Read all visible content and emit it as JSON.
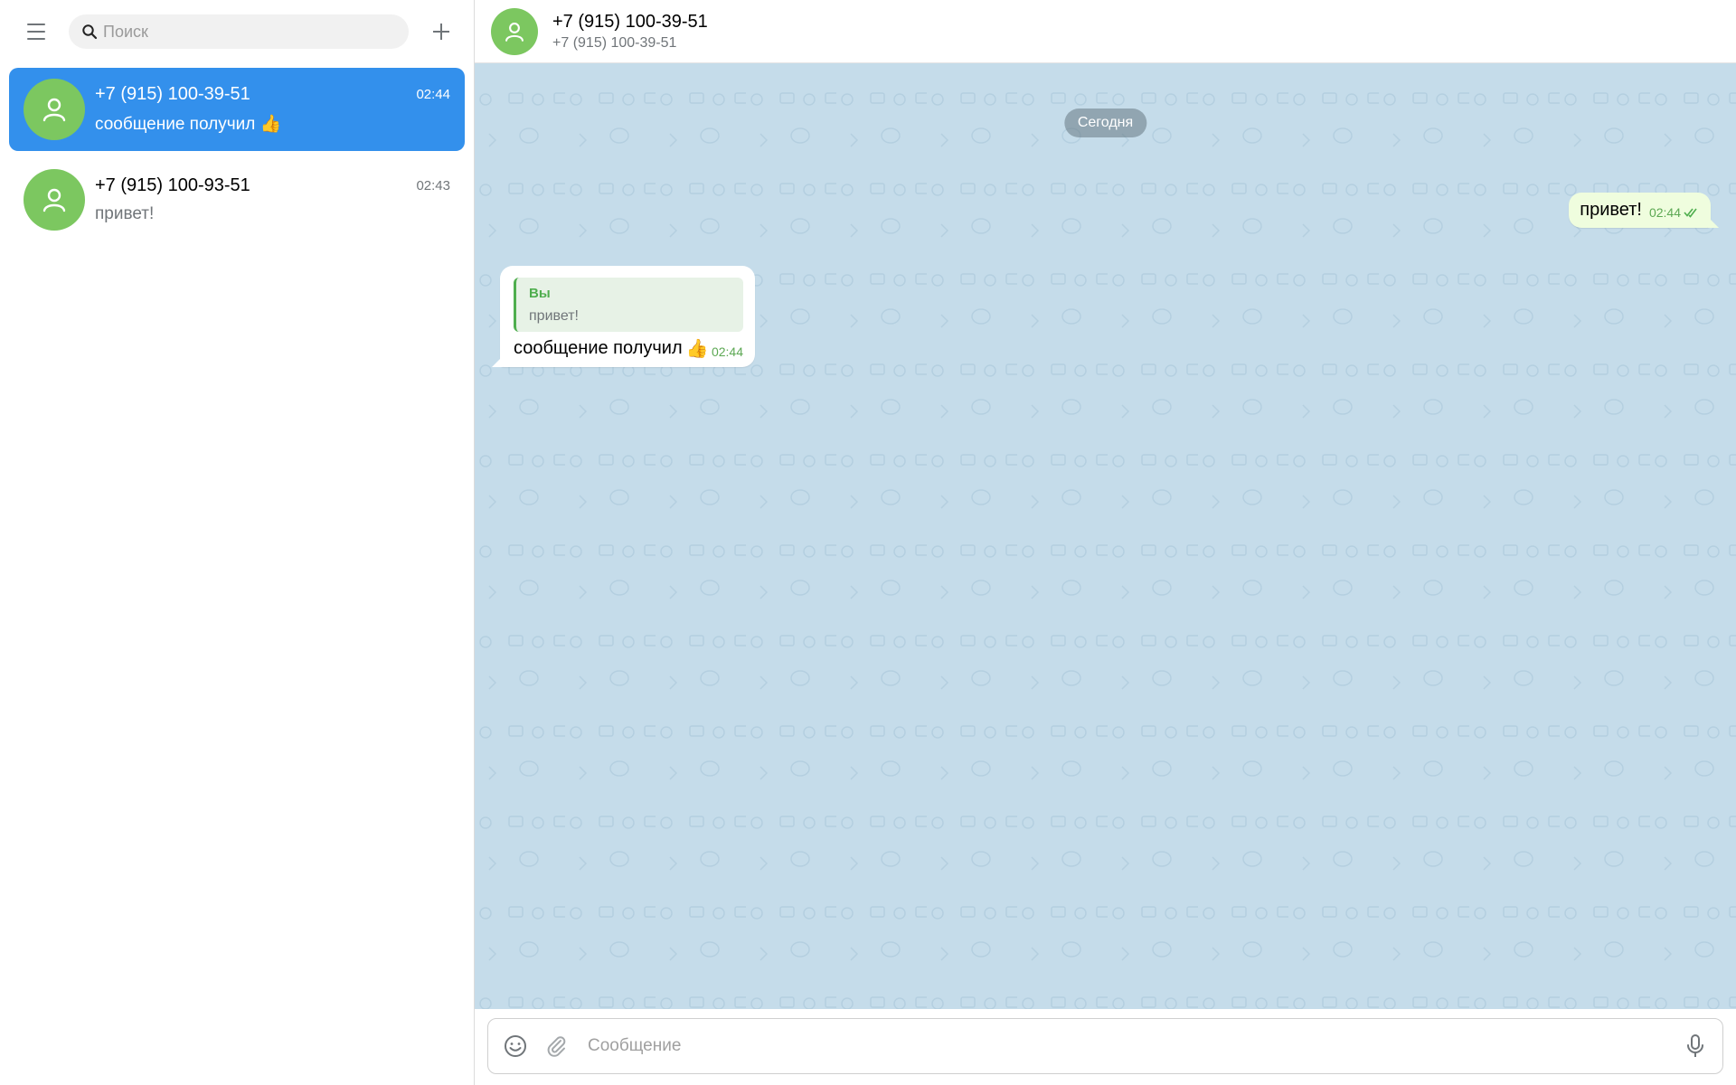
{
  "sidebar": {
    "search": {
      "placeholder": "Поиск"
    },
    "chats": [
      {
        "name": "+7 (915) 100-39-51",
        "time": "02:44",
        "preview": "сообщение получил",
        "preview_emoji": "👍",
        "active": true
      },
      {
        "name": "+7 (915) 100-93-51",
        "time": "02:43",
        "preview": "привет!",
        "active": false
      }
    ]
  },
  "header": {
    "title": "+7 (915) 100-39-51",
    "subtitle": "+7 (915) 100-39-51"
  },
  "messages": {
    "date_label": "Сегодня",
    "outgoing": {
      "text": "привет!",
      "time": "02:44",
      "status": "read"
    },
    "incoming": {
      "reply_author": "Вы",
      "reply_text": "привет!",
      "text": "сообщение получил",
      "emoji": "👍",
      "time": "02:44"
    }
  },
  "composer": {
    "placeholder": "Сообщение"
  },
  "colors": {
    "accent": "#3390ec",
    "avatar": "#7cc760",
    "chat_background": "#c5dcea",
    "outgoing_bubble": "#effdde",
    "time_green": "#5ca853"
  },
  "icons": {
    "menu": "hamburger-icon",
    "search": "search-icon",
    "new_chat": "plus-icon",
    "avatar": "user-icon",
    "emoji": "smile-icon",
    "attach": "paperclip-icon",
    "voice": "microphone-icon",
    "read": "double-check-icon"
  }
}
